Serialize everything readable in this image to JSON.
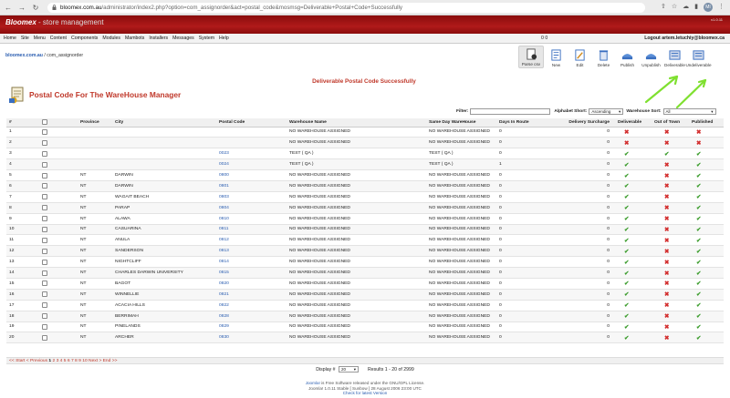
{
  "browser": {
    "url_host": "bloomex.com.au",
    "url_path": "/administrator/index2.php?option=com_assignorder&act=postal_code&mosmsg=Deliverable+Postal+Code+Successfully",
    "profile_initials": "MI"
  },
  "header": {
    "logo": "Bloomex",
    "logo_sub": " - store management",
    "version": "v1.0.11"
  },
  "menu": {
    "items": [
      "Home",
      "Site",
      "Menu",
      "Content",
      "Components",
      "Modules",
      "Mambots",
      "Installers",
      "Messages",
      "System",
      "Help"
    ],
    "counts": "0   0",
    "logout": "Logout artem.letuchiy@bloomex.ca"
  },
  "pathway": {
    "site": "bloomex.com.au",
    "rest": " / com_assignorder"
  },
  "toolbar": {
    "buttons": [
      "Parse csv",
      "New",
      "Edit",
      "Delete",
      "Publish",
      "Unpublish",
      "Deliverable",
      "Undeliverable"
    ]
  },
  "message": "Deliverable Postal Code Successfully",
  "page_title": "Postal Code For The WareHouse Manager",
  "filters": {
    "filter_label": "Filter:",
    "filter_value": "",
    "alpha_label": "Alphabet Short:",
    "alpha_value": "Ascending",
    "wh_label": "Warehouse Sort:",
    "wh_value": "All"
  },
  "table": {
    "headers": [
      "#",
      "",
      "Province",
      "City",
      "Postal Code",
      "Warehouse Name",
      "Same Day WareHouse",
      "Days In Route",
      "Delivery Surcharge",
      "Deliverable",
      "Out of Town",
      "Published"
    ],
    "rows": [
      {
        "n": "1",
        "province": "",
        "city": "",
        "pc": "",
        "wh": "NO WAREHOUSE ASSIGNED",
        "sd": "NO WAREHOUSE ASSIGNED",
        "days": "0",
        "sur": "0",
        "del": "x",
        "oot": "x",
        "pub": "x"
      },
      {
        "n": "2",
        "province": "",
        "city": "",
        "pc": "",
        "wh": "NO WAREHOUSE ASSIGNED",
        "sd": "NO WAREHOUSE ASSIGNED",
        "days": "0",
        "sur": "0",
        "del": "x",
        "oot": "x",
        "pub": "x"
      },
      {
        "n": "3",
        "province": "",
        "city": "",
        "pc": "0023",
        "wh": "TEST ( QA )",
        "sd": "TEST ( QA )",
        "days": "0",
        "sur": "0",
        "del": "v",
        "oot": "v",
        "pub": "v"
      },
      {
        "n": "4",
        "province": "",
        "city": "",
        "pc": "0024",
        "wh": "TEST ( QA )",
        "sd": "TEST ( QA )",
        "days": "1",
        "sur": "0",
        "del": "v",
        "oot": "x",
        "pub": "v"
      },
      {
        "n": "5",
        "province": "NT",
        "city": "DARWIN",
        "pc": "0800",
        "wh": "NO WAREHOUSE ASSIGNED",
        "sd": "NO WAREHOUSE ASSIGNED",
        "days": "0",
        "sur": "0",
        "del": "v",
        "oot": "x",
        "pub": "v"
      },
      {
        "n": "6",
        "province": "NT",
        "city": "DARWIN",
        "pc": "0801",
        "wh": "NO WAREHOUSE ASSIGNED",
        "sd": "NO WAREHOUSE ASSIGNED",
        "days": "0",
        "sur": "0",
        "del": "v",
        "oot": "x",
        "pub": "v"
      },
      {
        "n": "7",
        "province": "NT",
        "city": "WAGAIT BEACH",
        "pc": "0803",
        "wh": "NO WAREHOUSE ASSIGNED",
        "sd": "NO WAREHOUSE ASSIGNED",
        "days": "0",
        "sur": "0",
        "del": "v",
        "oot": "x",
        "pub": "v"
      },
      {
        "n": "8",
        "province": "NT",
        "city": "PARAP",
        "pc": "0804",
        "wh": "NO WAREHOUSE ASSIGNED",
        "sd": "NO WAREHOUSE ASSIGNED",
        "days": "0",
        "sur": "0",
        "del": "v",
        "oot": "x",
        "pub": "v"
      },
      {
        "n": "9",
        "province": "NT",
        "city": "ALAWA",
        "pc": "0810",
        "wh": "NO WAREHOUSE ASSIGNED",
        "sd": "NO WAREHOUSE ASSIGNED",
        "days": "0",
        "sur": "0",
        "del": "v",
        "oot": "x",
        "pub": "v"
      },
      {
        "n": "10",
        "province": "NT",
        "city": "CASUARINA",
        "pc": "0811",
        "wh": "NO WAREHOUSE ASSIGNED",
        "sd": "NO WAREHOUSE ASSIGNED",
        "days": "0",
        "sur": "0",
        "del": "v",
        "oot": "x",
        "pub": "v"
      },
      {
        "n": "11",
        "province": "NT",
        "city": "ANULA",
        "pc": "0812",
        "wh": "NO WAREHOUSE ASSIGNED",
        "sd": "NO WAREHOUSE ASSIGNED",
        "days": "0",
        "sur": "0",
        "del": "v",
        "oot": "x",
        "pub": "v"
      },
      {
        "n": "12",
        "province": "NT",
        "city": "SANDERSON",
        "pc": "0813",
        "wh": "NO WAREHOUSE ASSIGNED",
        "sd": "NO WAREHOUSE ASSIGNED",
        "days": "0",
        "sur": "0",
        "del": "v",
        "oot": "x",
        "pub": "v"
      },
      {
        "n": "13",
        "province": "NT",
        "city": "NIGHTCLIFF",
        "pc": "0814",
        "wh": "NO WAREHOUSE ASSIGNED",
        "sd": "NO WAREHOUSE ASSIGNED",
        "days": "0",
        "sur": "0",
        "del": "v",
        "oot": "x",
        "pub": "v"
      },
      {
        "n": "14",
        "province": "NT",
        "city": "CHARLES DARWIN UNIVERSITY",
        "pc": "0815",
        "wh": "NO WAREHOUSE ASSIGNED",
        "sd": "NO WAREHOUSE ASSIGNED",
        "days": "0",
        "sur": "0",
        "del": "v",
        "oot": "x",
        "pub": "v"
      },
      {
        "n": "15",
        "province": "NT",
        "city": "BAGOT",
        "pc": "0820",
        "wh": "NO WAREHOUSE ASSIGNED",
        "sd": "NO WAREHOUSE ASSIGNED",
        "days": "0",
        "sur": "0",
        "del": "v",
        "oot": "x",
        "pub": "v"
      },
      {
        "n": "16",
        "province": "NT",
        "city": "WINNELLIE",
        "pc": "0821",
        "wh": "NO WAREHOUSE ASSIGNED",
        "sd": "NO WAREHOUSE ASSIGNED",
        "days": "0",
        "sur": "0",
        "del": "v",
        "oot": "x",
        "pub": "v"
      },
      {
        "n": "17",
        "province": "NT",
        "city": "ACACIA HILLS",
        "pc": "0822",
        "wh": "NO WAREHOUSE ASSIGNED",
        "sd": "NO WAREHOUSE ASSIGNED",
        "days": "0",
        "sur": "0",
        "del": "v",
        "oot": "x",
        "pub": "v"
      },
      {
        "n": "18",
        "province": "NT",
        "city": "BERRIMAH",
        "pc": "0828",
        "wh": "NO WAREHOUSE ASSIGNED",
        "sd": "NO WAREHOUSE ASSIGNED",
        "days": "0",
        "sur": "0",
        "del": "v",
        "oot": "x",
        "pub": "v"
      },
      {
        "n": "19",
        "province": "NT",
        "city": "PINELANDS",
        "pc": "0829",
        "wh": "NO WAREHOUSE ASSIGNED",
        "sd": "NO WAREHOUSE ASSIGNED",
        "days": "0",
        "sur": "0",
        "del": "v",
        "oot": "x",
        "pub": "v"
      },
      {
        "n": "20",
        "province": "NT",
        "city": "ARCHER",
        "pc": "0830",
        "wh": "NO WAREHOUSE ASSIGNED",
        "sd": "NO WAREHOUSE ASSIGNED",
        "days": "0",
        "sur": "0",
        "del": "v",
        "oot": "x",
        "pub": "v"
      }
    ]
  },
  "pager": {
    "start": "<< Start",
    "prev": "< Previous",
    "pages": [
      "1",
      "2",
      "3",
      "4",
      "5",
      "6",
      "7",
      "8",
      "9",
      "10"
    ],
    "next": "Next >",
    "end": "End >>"
  },
  "display": {
    "label": "Display #",
    "value": "20",
    "results": "Results 1 - 20 of 2999"
  },
  "footer": {
    "line1_link": "Joomla!",
    "line1_rest": " is Free Software released under the GNU/GPL License.",
    "line2": "Joomla! 1.0.11 Stable [ Sunbow ] 28 August 2006 23:00 UTC",
    "line3": "Check for latest Version"
  },
  "colors": {
    "header_red": "#8a0c0c",
    "title_red": "#c0392b",
    "link_blue": "#2a5db0",
    "check_green": "#3b9c2c",
    "cross_red": "#d32f2f",
    "arrow_green": "#7fe030"
  }
}
